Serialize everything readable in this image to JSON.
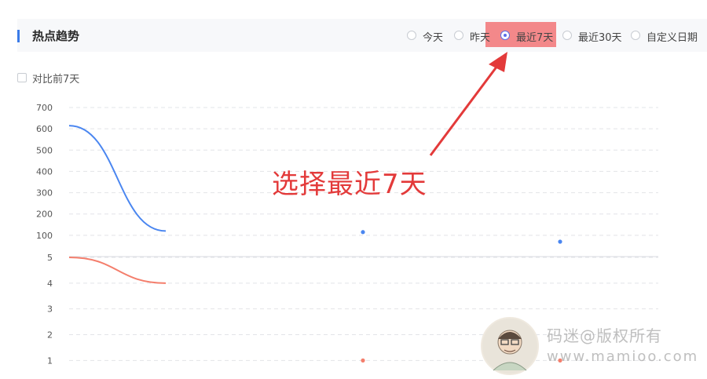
{
  "header": {
    "title": "热点趋势",
    "accent_color": "#3b7be8"
  },
  "date_range": {
    "options": [
      "今天",
      "昨天",
      "最近7天",
      "最近30天",
      "自定义日期"
    ],
    "selected": "最近7天",
    "highlight_color": "#f3888a"
  },
  "compare": {
    "label": "对比前7天",
    "checked": false
  },
  "chart_data": [
    {
      "type": "line",
      "x": [
        1,
        2,
        3,
        4
      ],
      "series": [
        {
          "color": "#4a86f0",
          "values": [
            615,
            120,
            115,
            70
          ]
        }
      ],
      "yticks": [
        100,
        200,
        300,
        400,
        500,
        600,
        700
      ],
      "ylim": [
        0,
        700
      ],
      "grid": true
    },
    {
      "type": "line",
      "x": [
        1,
        2,
        3,
        4
      ],
      "series": [
        {
          "color": "#f47e6c",
          "values": [
            5,
            4,
            1,
            1
          ]
        }
      ],
      "yticks": [
        1,
        2,
        3,
        4,
        5
      ],
      "ylim": [
        0.95,
        5
      ],
      "grid": true
    }
  ],
  "annotation": {
    "text": "选择最近7天",
    "color": "#e33a3a"
  },
  "watermark": {
    "line1": "码迷@版权所有",
    "line2": "www.mamioo.com"
  }
}
